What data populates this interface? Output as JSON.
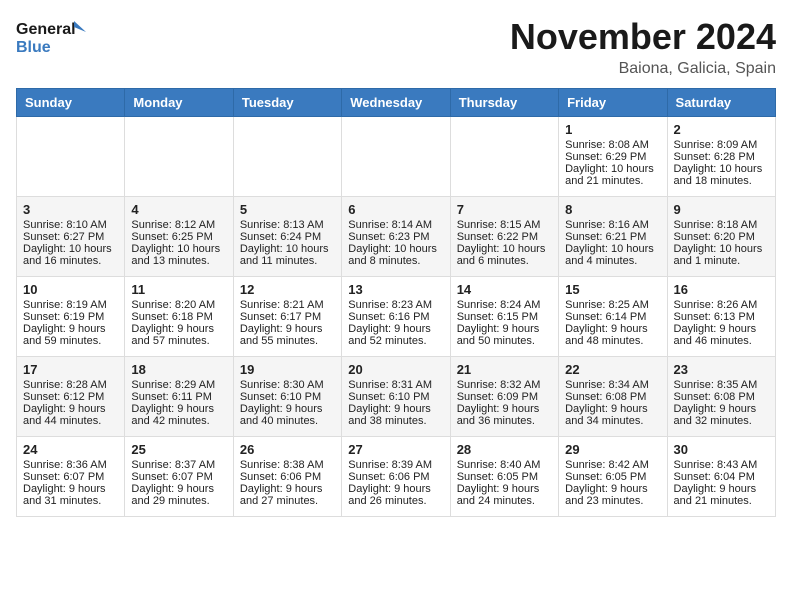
{
  "header": {
    "logo_line1": "General",
    "logo_line2": "Blue",
    "month_title": "November 2024",
    "location": "Baiona, Galicia, Spain"
  },
  "days_of_week": [
    "Sunday",
    "Monday",
    "Tuesday",
    "Wednesday",
    "Thursday",
    "Friday",
    "Saturday"
  ],
  "weeks": [
    [
      {
        "day": "",
        "sunrise": "",
        "sunset": "",
        "daylight": ""
      },
      {
        "day": "",
        "sunrise": "",
        "sunset": "",
        "daylight": ""
      },
      {
        "day": "",
        "sunrise": "",
        "sunset": "",
        "daylight": ""
      },
      {
        "day": "",
        "sunrise": "",
        "sunset": "",
        "daylight": ""
      },
      {
        "day": "",
        "sunrise": "",
        "sunset": "",
        "daylight": ""
      },
      {
        "day": "1",
        "sunrise": "Sunrise: 8:08 AM",
        "sunset": "Sunset: 6:29 PM",
        "daylight": "Daylight: 10 hours and 21 minutes."
      },
      {
        "day": "2",
        "sunrise": "Sunrise: 8:09 AM",
        "sunset": "Sunset: 6:28 PM",
        "daylight": "Daylight: 10 hours and 18 minutes."
      }
    ],
    [
      {
        "day": "3",
        "sunrise": "Sunrise: 8:10 AM",
        "sunset": "Sunset: 6:27 PM",
        "daylight": "Daylight: 10 hours and 16 minutes."
      },
      {
        "day": "4",
        "sunrise": "Sunrise: 8:12 AM",
        "sunset": "Sunset: 6:25 PM",
        "daylight": "Daylight: 10 hours and 13 minutes."
      },
      {
        "day": "5",
        "sunrise": "Sunrise: 8:13 AM",
        "sunset": "Sunset: 6:24 PM",
        "daylight": "Daylight: 10 hours and 11 minutes."
      },
      {
        "day": "6",
        "sunrise": "Sunrise: 8:14 AM",
        "sunset": "Sunset: 6:23 PM",
        "daylight": "Daylight: 10 hours and 8 minutes."
      },
      {
        "day": "7",
        "sunrise": "Sunrise: 8:15 AM",
        "sunset": "Sunset: 6:22 PM",
        "daylight": "Daylight: 10 hours and 6 minutes."
      },
      {
        "day": "8",
        "sunrise": "Sunrise: 8:16 AM",
        "sunset": "Sunset: 6:21 PM",
        "daylight": "Daylight: 10 hours and 4 minutes."
      },
      {
        "day": "9",
        "sunrise": "Sunrise: 8:18 AM",
        "sunset": "Sunset: 6:20 PM",
        "daylight": "Daylight: 10 hours and 1 minute."
      }
    ],
    [
      {
        "day": "10",
        "sunrise": "Sunrise: 8:19 AM",
        "sunset": "Sunset: 6:19 PM",
        "daylight": "Daylight: 9 hours and 59 minutes."
      },
      {
        "day": "11",
        "sunrise": "Sunrise: 8:20 AM",
        "sunset": "Sunset: 6:18 PM",
        "daylight": "Daylight: 9 hours and 57 minutes."
      },
      {
        "day": "12",
        "sunrise": "Sunrise: 8:21 AM",
        "sunset": "Sunset: 6:17 PM",
        "daylight": "Daylight: 9 hours and 55 minutes."
      },
      {
        "day": "13",
        "sunrise": "Sunrise: 8:23 AM",
        "sunset": "Sunset: 6:16 PM",
        "daylight": "Daylight: 9 hours and 52 minutes."
      },
      {
        "day": "14",
        "sunrise": "Sunrise: 8:24 AM",
        "sunset": "Sunset: 6:15 PM",
        "daylight": "Daylight: 9 hours and 50 minutes."
      },
      {
        "day": "15",
        "sunrise": "Sunrise: 8:25 AM",
        "sunset": "Sunset: 6:14 PM",
        "daylight": "Daylight: 9 hours and 48 minutes."
      },
      {
        "day": "16",
        "sunrise": "Sunrise: 8:26 AM",
        "sunset": "Sunset: 6:13 PM",
        "daylight": "Daylight: 9 hours and 46 minutes."
      }
    ],
    [
      {
        "day": "17",
        "sunrise": "Sunrise: 8:28 AM",
        "sunset": "Sunset: 6:12 PM",
        "daylight": "Daylight: 9 hours and 44 minutes."
      },
      {
        "day": "18",
        "sunrise": "Sunrise: 8:29 AM",
        "sunset": "Sunset: 6:11 PM",
        "daylight": "Daylight: 9 hours and 42 minutes."
      },
      {
        "day": "19",
        "sunrise": "Sunrise: 8:30 AM",
        "sunset": "Sunset: 6:10 PM",
        "daylight": "Daylight: 9 hours and 40 minutes."
      },
      {
        "day": "20",
        "sunrise": "Sunrise: 8:31 AM",
        "sunset": "Sunset: 6:10 PM",
        "daylight": "Daylight: 9 hours and 38 minutes."
      },
      {
        "day": "21",
        "sunrise": "Sunrise: 8:32 AM",
        "sunset": "Sunset: 6:09 PM",
        "daylight": "Daylight: 9 hours and 36 minutes."
      },
      {
        "day": "22",
        "sunrise": "Sunrise: 8:34 AM",
        "sunset": "Sunset: 6:08 PM",
        "daylight": "Daylight: 9 hours and 34 minutes."
      },
      {
        "day": "23",
        "sunrise": "Sunrise: 8:35 AM",
        "sunset": "Sunset: 6:08 PM",
        "daylight": "Daylight: 9 hours and 32 minutes."
      }
    ],
    [
      {
        "day": "24",
        "sunrise": "Sunrise: 8:36 AM",
        "sunset": "Sunset: 6:07 PM",
        "daylight": "Daylight: 9 hours and 31 minutes."
      },
      {
        "day": "25",
        "sunrise": "Sunrise: 8:37 AM",
        "sunset": "Sunset: 6:07 PM",
        "daylight": "Daylight: 9 hours and 29 minutes."
      },
      {
        "day": "26",
        "sunrise": "Sunrise: 8:38 AM",
        "sunset": "Sunset: 6:06 PM",
        "daylight": "Daylight: 9 hours and 27 minutes."
      },
      {
        "day": "27",
        "sunrise": "Sunrise: 8:39 AM",
        "sunset": "Sunset: 6:06 PM",
        "daylight": "Daylight: 9 hours and 26 minutes."
      },
      {
        "day": "28",
        "sunrise": "Sunrise: 8:40 AM",
        "sunset": "Sunset: 6:05 PM",
        "daylight": "Daylight: 9 hours and 24 minutes."
      },
      {
        "day": "29",
        "sunrise": "Sunrise: 8:42 AM",
        "sunset": "Sunset: 6:05 PM",
        "daylight": "Daylight: 9 hours and 23 minutes."
      },
      {
        "day": "30",
        "sunrise": "Sunrise: 8:43 AM",
        "sunset": "Sunset: 6:04 PM",
        "daylight": "Daylight: 9 hours and 21 minutes."
      }
    ]
  ]
}
